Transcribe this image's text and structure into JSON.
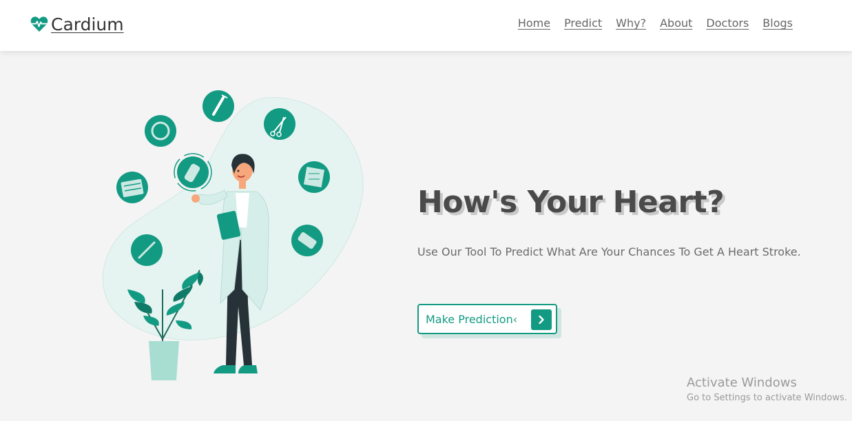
{
  "brand": {
    "name": "Cardium",
    "icon": "heart-pulse-icon",
    "color": "#139a83"
  },
  "nav": {
    "items": [
      {
        "label": "Home"
      },
      {
        "label": "Predict"
      },
      {
        "label": "Why?"
      },
      {
        "label": "About"
      },
      {
        "label": "Doctors"
      },
      {
        "label": "Blogs"
      }
    ]
  },
  "hero": {
    "title": "How's Your Heart?",
    "subtitle": "Use Our Tool To Predict What Are Your Chances To Get A Heart Stroke.",
    "cta_label": "Make Prediction‹",
    "cta_icon": "chevron-right-icon"
  },
  "illustration": {
    "icons": [
      "syringe-icon",
      "ring-icon",
      "scissors-icon",
      "bandage-icon",
      "gauze-icon",
      "calendar-icon",
      "pills-icon",
      "thermometer-icon"
    ]
  },
  "watermark": {
    "title": "Activate Windows",
    "subtitle": "Go to Settings to activate Windows."
  },
  "colors": {
    "accent": "#139a83",
    "background": "#f4f4f4",
    "navbar": "#ffffff"
  }
}
